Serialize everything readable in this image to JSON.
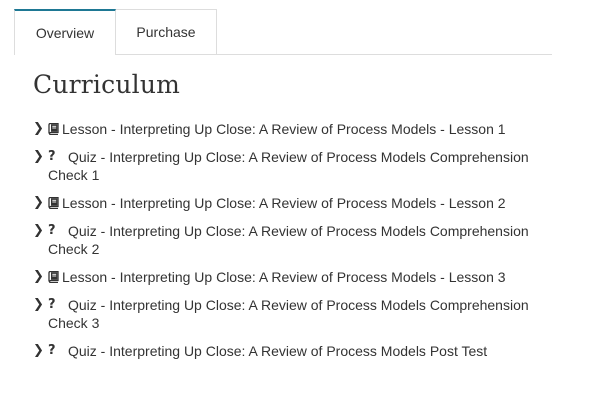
{
  "tabs": [
    {
      "label": "Overview",
      "active": true
    },
    {
      "label": "Purchase",
      "active": false
    }
  ],
  "accent_color": "#1e7894",
  "heading": "Curriculum",
  "items": [
    {
      "icon": "book-icon",
      "label": "Lesson - Interpreting Up Close: A Review of Process Models - Lesson 1"
    },
    {
      "icon": "question-icon",
      "label": "Quiz - Interpreting Up Close: A Review of Process Models Comprehension Check 1"
    },
    {
      "icon": "book-icon",
      "label": "Lesson - Interpreting Up Close: A Review of Process Models - Lesson 2"
    },
    {
      "icon": "question-icon",
      "label": "Quiz - Interpreting Up Close: A Review of Process Models Comprehension Check 2"
    },
    {
      "icon": "book-icon",
      "label": "Lesson - Interpreting Up Close: A Review of Process Models - Lesson 3"
    },
    {
      "icon": "question-icon",
      "label": "Quiz - Interpreting Up Close: A Review of Process Models Comprehension Check 3"
    },
    {
      "icon": "question-icon",
      "label": "Quiz - Interpreting Up Close: A Review of Process Models Post Test"
    }
  ]
}
